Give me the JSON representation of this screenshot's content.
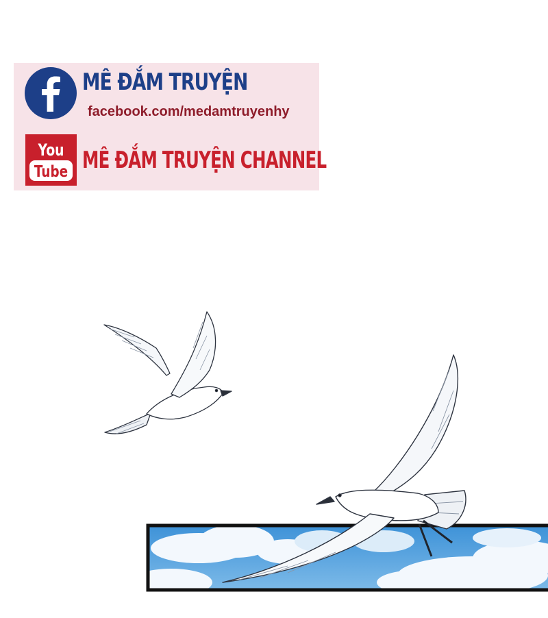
{
  "banner": {
    "facebook_title": "MÊ ĐẮM TRUYỆN",
    "facebook_url": "facebook.com/medamtruyenhy",
    "youtube_logo_top": "You",
    "youtube_logo_bottom": "Tube",
    "youtube_title": "MÊ ĐẮM TRUYỆN CHANNEL"
  },
  "colors": {
    "banner_bg": "#f7e3e8",
    "facebook_blue": "#1d3f88",
    "youtube_red": "#c8202c",
    "url_text": "#8e1c2a",
    "sky_blue": "#4f9fdc"
  },
  "icons": [
    "facebook-icon",
    "youtube-icon"
  ]
}
